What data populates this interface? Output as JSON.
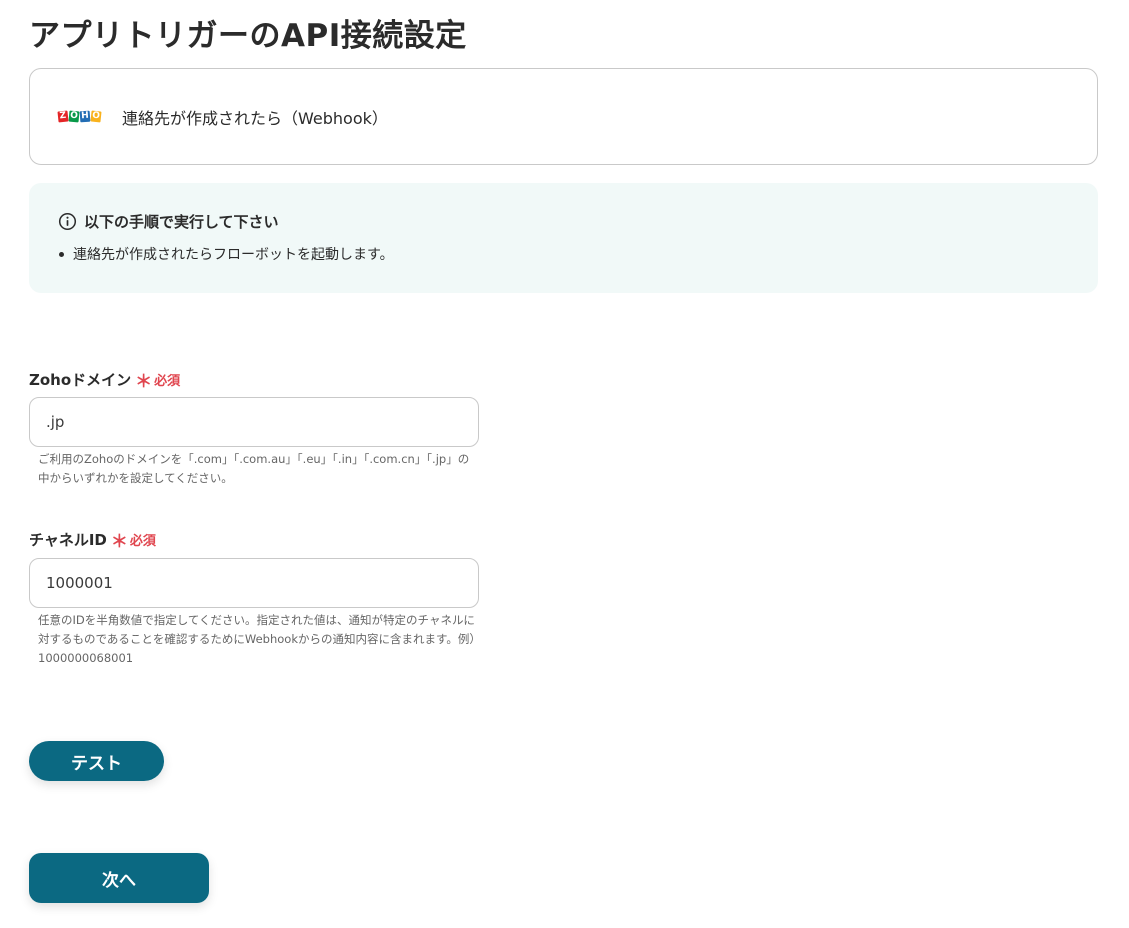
{
  "page": {
    "title": "アプリトリガーのAPI接続設定"
  },
  "trigger": {
    "app_icon": "zoho-logo",
    "logo_letters": [
      "Z",
      "O",
      "H",
      "O"
    ],
    "label": "連絡先が作成されたら（Webhook）"
  },
  "info": {
    "icon": "info-circle-icon",
    "heading": "以下の手順で実行して下さい",
    "items": [
      "連絡先が作成されたらフローボットを起動します。"
    ]
  },
  "fields": {
    "domain": {
      "label": "Zohoドメイン",
      "required_mark": "＊",
      "required_text": "必須",
      "value": ".jp",
      "help": "ご利用のZohoのドメインを「.com」「.com.au」「.eu」「.in」「.com.cn」「.jp」の中からいずれかを設定してください。"
    },
    "channel_id": {
      "label": "チャネルID",
      "required_mark": "＊",
      "required_text": "必須",
      "value": "1000001",
      "help": "任意のIDを半角数値で指定してください。指定された値は、通知が特定のチャネルに対するものであることを確認するためにWebhookからの通知内容に含まれます。例）1000000068001"
    }
  },
  "buttons": {
    "test": "テスト",
    "next": "次へ"
  },
  "colors": {
    "primary": "#0b6982",
    "required": "#e0464f",
    "info_bg": "#f1f9f8"
  }
}
